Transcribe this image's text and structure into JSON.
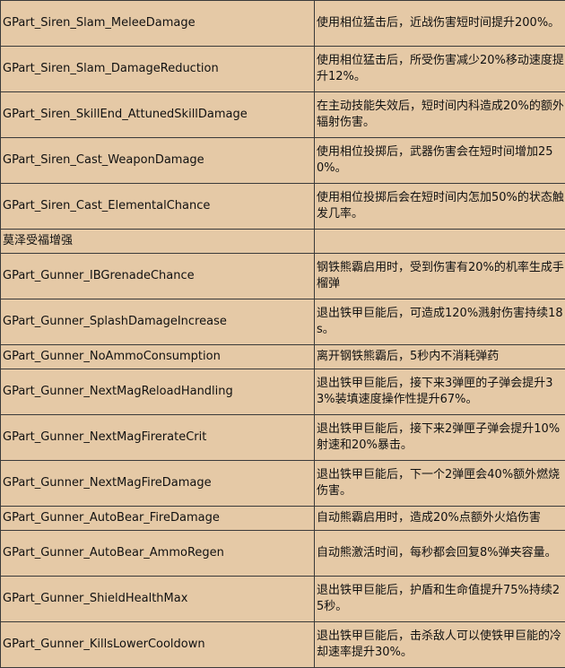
{
  "table": {
    "rows": [
      {
        "key": "GPart_Siren_Slam_MeleeDamage",
        "desc": "使用相位猛击后，近战伤害短时间提升200%。"
      },
      {
        "key": "GPart_Siren_Slam_DamageReduction",
        "desc": "使用相位猛击后，所受伤害减少20%移动速度提升12%。"
      },
      {
        "key": "GPart_Siren_SkillEnd_AttunedSkillDamage",
        "desc": "在主动技能失效后，短时间内科造成20%的额外辐射伤害。"
      },
      {
        "key": "GPart_Siren_Cast_WeaponDamage",
        "desc": "使用相位投掷后，武器伤害会在短时间增加250%。"
      },
      {
        "key": "GPart_Siren_Cast_ElementalChance",
        "desc": "使用相位投掷后会在短时间内怎加50%的状态触发几率。"
      },
      {
        "key": "莫泽受福增强",
        "desc": ""
      },
      {
        "key": "GPart_Gunner_IBGrenadeChance",
        "desc": "钢铁熊霸启用时，受到伤害有20%的机率生成手榴弹"
      },
      {
        "key": "GPart_Gunner_SplashDamageIncrease",
        "desc": "退出铁甲巨能后，可造成120%溅射伤害持续18s。"
      },
      {
        "key": "GPart_Gunner_NoAmmoConsumption",
        "desc": "离开钢铁熊霸后，5秒内不消耗弹药"
      },
      {
        "key": "GPart_Gunner_NextMagReloadHandling",
        "desc": "退出铁甲巨能后，接下来3弹匣的子弹会提升33%装填速度操作性提升67%。"
      },
      {
        "key": "GPart_Gunner_NextMagFirerateCrit",
        "desc": "退出铁甲巨能后，接下来2弹匣子弹会提升10%射速和20%暴击。"
      },
      {
        "key": "GPart_Gunner_NextMagFireDamage",
        "desc": "退出铁甲巨能后，下一个2弹匣会40%额外燃烧伤害。"
      },
      {
        "key": "GPart_Gunner_AutoBear_FireDamage",
        "desc": "自动熊霸启用时，造成20%点额外火焰伤害"
      },
      {
        "key": "GPart_Gunner_AutoBear_AmmoRegen",
        "desc": "自动熊激活时间，每秒都会回复8%弹夹容量。"
      },
      {
        "key": "GPart_Gunner_ShieldHealthMax",
        "desc": "退出铁甲巨能后，护盾和生命值提升75%持续25秒。"
      },
      {
        "key": "GPart_Gunner_KillsLowerCooldown",
        "desc": "退出铁甲巨能后，击杀敌人可以使铁甲巨能的冷却速率提升30%。"
      }
    ]
  }
}
